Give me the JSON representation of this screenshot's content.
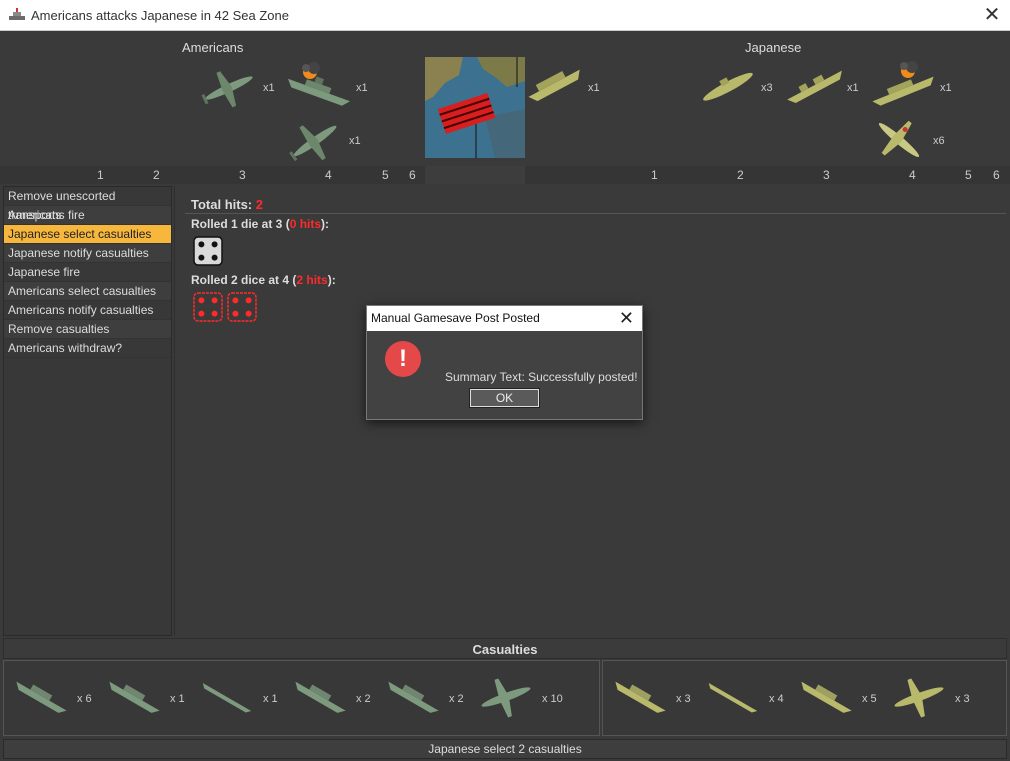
{
  "window": {
    "title": "Americans attacks Japanese in 42 Sea Zone",
    "close_glyph": "✕"
  },
  "attacker": {
    "name": "Americans",
    "units": [
      {
        "icon": "fighter-plane-icon",
        "count": "x1"
      },
      {
        "icon": "damaged-battleship-icon",
        "count": "x1"
      },
      {
        "icon": "fighter-plane-icon",
        "count": "x1"
      }
    ]
  },
  "defender": {
    "name": "Japanese",
    "units": [
      {
        "icon": "transport-ship-icon",
        "count": "x1"
      },
      {
        "icon": "submarine-icon",
        "count": "x3"
      },
      {
        "icon": "destroyer-icon",
        "count": "x1"
      },
      {
        "icon": "damaged-battleship-icon",
        "count": "x1"
      },
      {
        "icon": "fighter-plane-icon",
        "count": "x6"
      }
    ]
  },
  "dice_labels": [
    "1",
    "2",
    "3",
    "4",
    "5",
    "6"
  ],
  "steps": [
    "Remove unescorted transports",
    "Americans fire",
    "Japanese select casualties",
    "Japanese notify casualties",
    "Japanese fire",
    "Americans select casualties",
    "Americans notify casualties",
    "Remove casualties",
    "Americans withdraw?"
  ],
  "active_step_index": 2,
  "results": {
    "total_label": "Total hits: ",
    "total_value": "2",
    "roll1_prefix": "Rolled 1 die at 3 (",
    "roll1_hits": "0 hits",
    "roll1_suffix": "):",
    "roll2_prefix": "Rolled 2 dice at 4 (",
    "roll2_hits": "2 hits",
    "roll2_suffix": "):",
    "roll1_dice": [
      {
        "value": 4,
        "hit": false
      }
    ],
    "roll2_dice": [
      {
        "value": 4,
        "hit": true
      },
      {
        "value": 4,
        "hit": true
      }
    ]
  },
  "casualties": {
    "title": "Casualties",
    "left": [
      {
        "icon": "transport-ship-icon",
        "count": "x 6"
      },
      {
        "icon": "destroyer-icon",
        "count": "x 1"
      },
      {
        "icon": "submarine-icon",
        "count": "x 1"
      },
      {
        "icon": "cruiser-icon",
        "count": "x 2"
      },
      {
        "icon": "battleship-icon",
        "count": "x 2"
      },
      {
        "icon": "fighter-plane-icon",
        "count": "x 10"
      }
    ],
    "right": [
      {
        "icon": "destroyer-icon",
        "count": "x 3"
      },
      {
        "icon": "submarine-icon",
        "count": "x 4"
      },
      {
        "icon": "transport-ship-icon",
        "count": "x 5"
      },
      {
        "icon": "fighter-plane-icon",
        "count": "x 3"
      }
    ]
  },
  "status": "Japanese select 2 casualties",
  "dialog": {
    "title": "Manual Gamesave Post Posted",
    "close_glyph": "✕",
    "icon": "error-icon",
    "icon_glyph": "!",
    "message": "Summary Text: Successfully posted!",
    "ok_label": "OK"
  },
  "colors": {
    "american_units": "#7e9a7e",
    "japanese_units": "#b9b96b",
    "active_step": "#f6b73c",
    "hit_red": "#ff2a2a",
    "error_red": "#e54848"
  }
}
